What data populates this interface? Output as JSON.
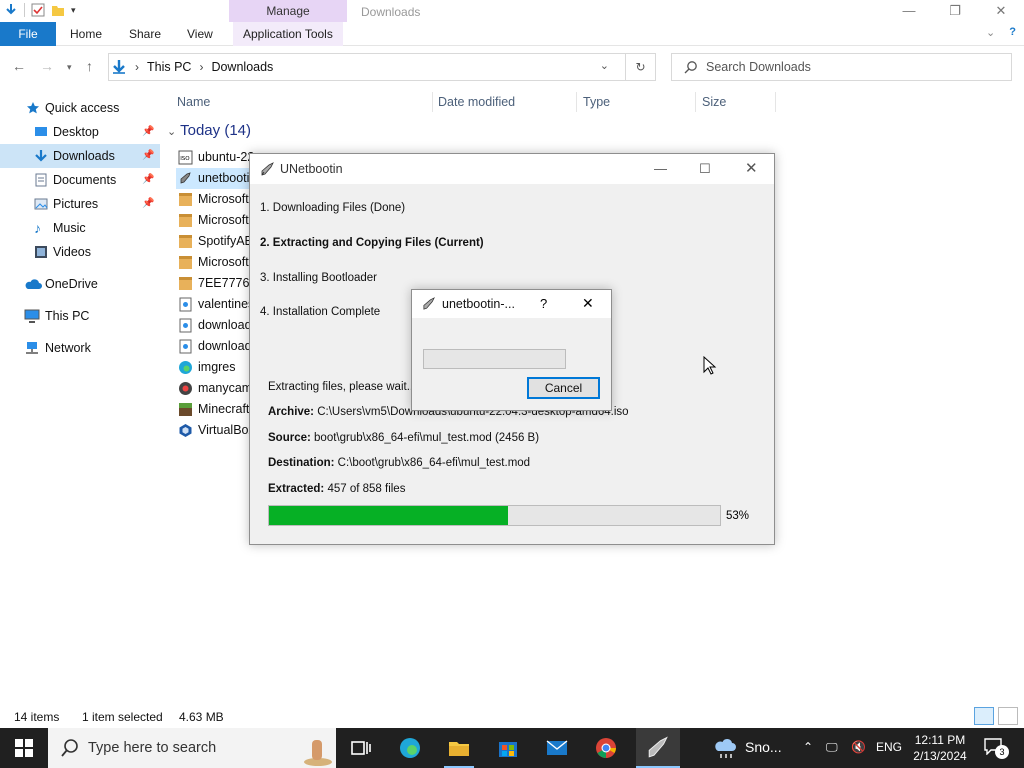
{
  "explorer": {
    "manage_tab": "Manage",
    "window_title": "Downloads",
    "ribbon_tabs": [
      "File",
      "Home",
      "Share",
      "View",
      "Application Tools"
    ],
    "address": {
      "root": "This PC",
      "folder": "Downloads"
    },
    "search_placeholder": "Search Downloads",
    "nav": {
      "quick_access": "Quick access",
      "desktop": "Desktop",
      "downloads": "Downloads",
      "documents": "Documents",
      "pictures": "Pictures",
      "music": "Music",
      "videos": "Videos",
      "onedrive": "OneDrive",
      "this_pc": "This PC",
      "network": "Network"
    },
    "columns": [
      "Name",
      "Date modified",
      "Type",
      "Size"
    ],
    "group_label": "Today (14)",
    "files": [
      "ubuntu-22",
      "unetbootin",
      "Microsoft",
      "Microsoft",
      "SpotifyAB",
      "Microsoft",
      "7EE7776C",
      "valentines",
      "download",
      "download",
      "imgres",
      "manycam",
      "Minecraft",
      "VirtualBox"
    ],
    "status": {
      "items": "14 items",
      "selected": "1 item selected",
      "size": "4.63 MB"
    }
  },
  "unetbootin": {
    "title": "UNetbootin",
    "steps": [
      "1. Downloading Files (Done)",
      "2. Extracting and Copying Files (Current)",
      "3. Installing Bootloader",
      "4. Installation Complete"
    ],
    "message": "Extracting files, please wait...",
    "archive_label": "Archive:",
    "archive_value": "C:\\Users\\vm5\\Downloads\\ubuntu-22.04.3-desktop-amd64.iso",
    "source_label": "Source:",
    "source_value": "boot\\grub\\x86_64-efi\\mul_test.mod (2456 B)",
    "destination_label": "Destination:",
    "destination_value": "C:\\boot\\grub\\x86_64-efi\\mul_test.mod",
    "extracted_label": "Extracted:",
    "extracted_value": "457 of 858 files",
    "progress_percent": 53,
    "progress_text": "53%"
  },
  "dialog": {
    "title": "unetbootin-...",
    "help": "?",
    "cancel_label": "Cancel",
    "progress_percent": 0
  },
  "taskbar": {
    "search_placeholder": "Type here to search",
    "weather_text": "Sno...",
    "language": "ENG",
    "time": "12:11 PM",
    "date": "2/13/2024",
    "notifications": "3"
  },
  "colors": {
    "accent": "#0078d7",
    "file_tab": "#1979ca",
    "progress": "#06b025",
    "selection": "#cce8ff",
    "manage_tab": "#e7d5f5"
  }
}
